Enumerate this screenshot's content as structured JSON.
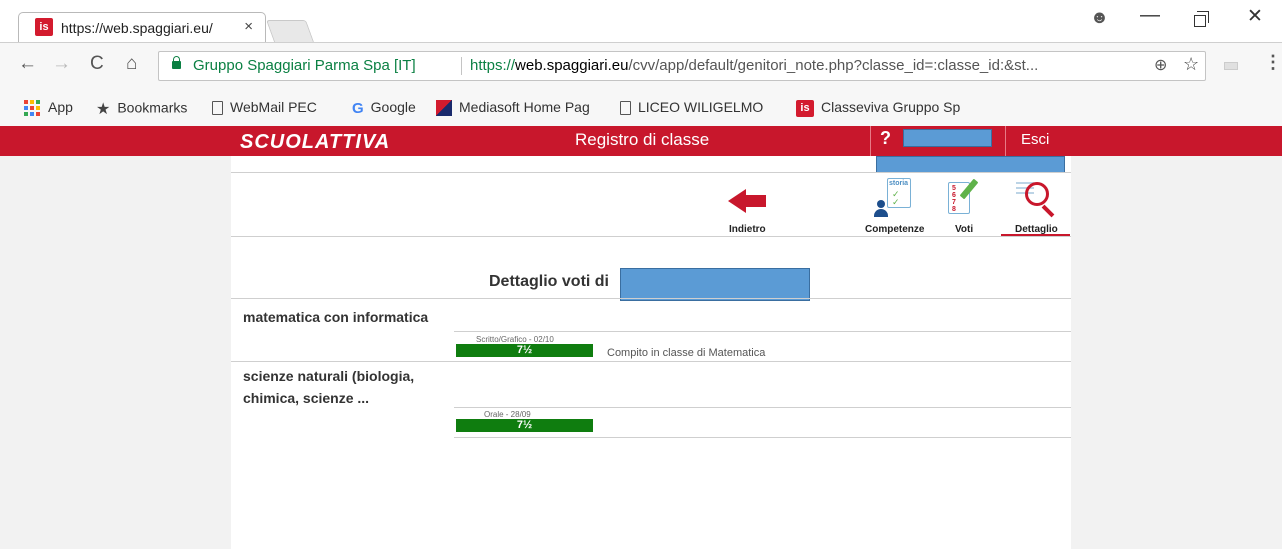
{
  "browser": {
    "tab": {
      "title": "https://web.spaggiari.eu/",
      "favicon": "is",
      "close": "×"
    },
    "window_controls": {
      "profile": "☻",
      "minimize": "—",
      "close": "✕"
    },
    "nav": {
      "back": "←",
      "forward": "→",
      "reload": "C",
      "home": "⌂"
    },
    "omnibox": {
      "security_label": "Gruppo Spaggiari Parma Spa [IT]",
      "url_scheme": "https://",
      "url_host": "web.spaggiari.eu",
      "url_path": "/cvv/app/default/genitori_note.php?classe_id=:classe_id:&st...",
      "zoom": "⊕",
      "star": "☆"
    },
    "menu": "⋮",
    "bookmarks": [
      {
        "label": "App",
        "icon": "apps-icon"
      },
      {
        "label": "Bookmarks",
        "icon": "star-icon"
      },
      {
        "label": "WebMail PEC",
        "icon": "page-icon"
      },
      {
        "label": "Google",
        "icon": "google-icon"
      },
      {
        "label": "Mediasoft Home Pag",
        "icon": "mediasoft-icon"
      },
      {
        "label": "LICEO WILIGELMO",
        "icon": "page-icon"
      },
      {
        "label": "Classeviva Gruppo Sp",
        "icon": "spaggiari-icon"
      }
    ]
  },
  "header": {
    "logo": "SCUOLATTIVA",
    "title": "Registro di classe",
    "help": "?",
    "logout": "Esci",
    "colors": {
      "brand": "#c8172c",
      "redaction": "#5b9bd5",
      "grade": "#0f7d0f"
    }
  },
  "toolbar": {
    "back": "Indietro",
    "competenze": "Competenze",
    "competenze_card": "storia",
    "voti": "Voti",
    "voti_numbers": [
      "5",
      "6",
      "7",
      "8"
    ],
    "dettaglio": "Dettaglio"
  },
  "main": {
    "title": "Dettaglio voti di",
    "subjects": [
      {
        "name": "matematica con informatica",
        "grades": [
          {
            "type": "Scritto/Grafico - 02/10",
            "value": "7½",
            "note": "Compito in classe di Matematica"
          }
        ]
      },
      {
        "name": "scienze naturali (biologia, chimica, scienze ...",
        "grades": [
          {
            "type": "Orale - 28/09",
            "value": "7½",
            "note": ""
          }
        ]
      }
    ]
  }
}
